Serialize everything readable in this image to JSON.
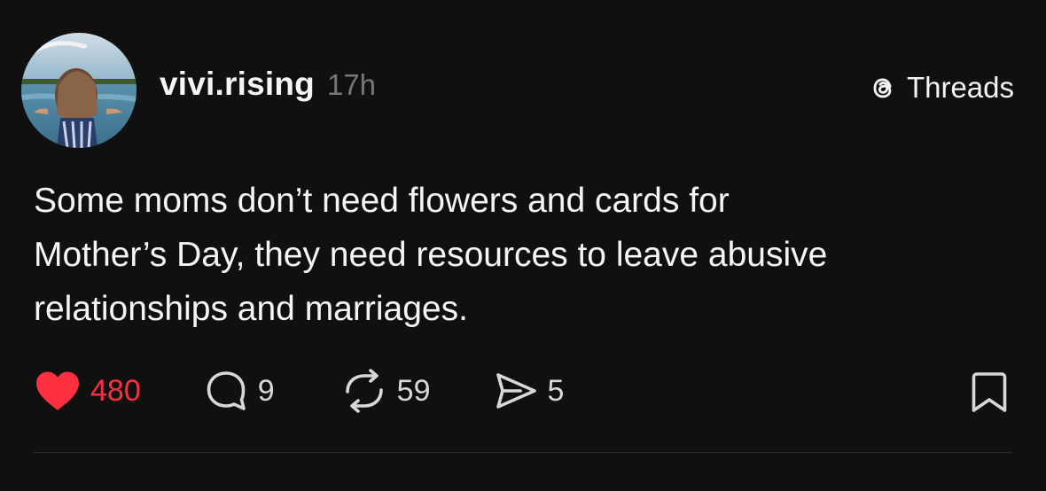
{
  "post": {
    "username": "vivi.rising",
    "timestamp": "17h",
    "brand_label": "Threads",
    "body_lines": [
      "Some moms don’t need flowers and cards for",
      "Mother’s Day, they need resources to leave abusive",
      "relationships and marriages."
    ],
    "actions": {
      "likes": "480",
      "replies": "9",
      "reposts": "59",
      "shares": "5"
    }
  },
  "colors": {
    "background": "#101010",
    "text": "#f3f5f7",
    "muted": "#777777",
    "like_red": "#ff3040"
  },
  "icons": {
    "brand": "threads-logo-icon",
    "like": "heart-filled-icon",
    "reply": "speech-bubble-icon",
    "repost": "repost-arrows-icon",
    "share": "send-plane-icon",
    "bookmark": "bookmark-icon"
  }
}
